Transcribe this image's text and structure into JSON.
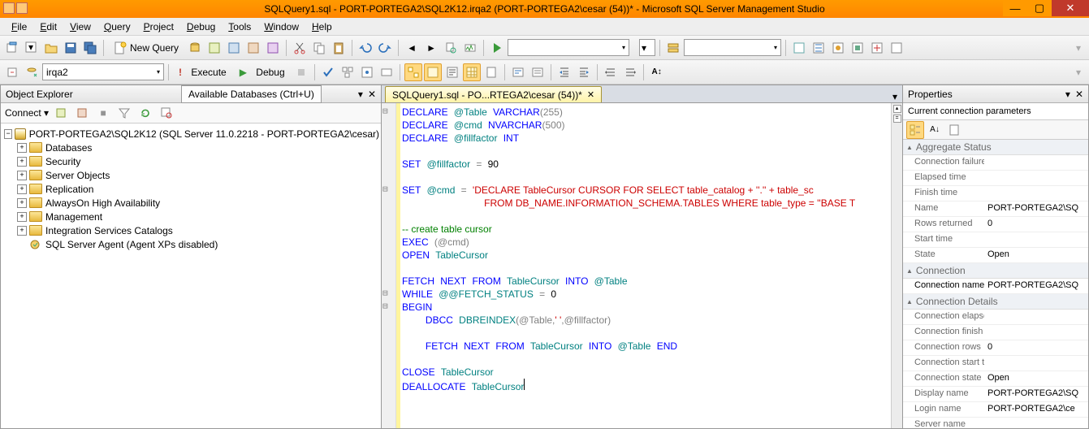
{
  "title": "SQLQuery1.sql - PORT-PORTEGA2\\SQL2K12.irqa2 (PORT-PORTEGA2\\cesar (54))* - Microsoft SQL Server Management Studio",
  "menu": [
    "File",
    "Edit",
    "View",
    "Query",
    "Project",
    "Debug",
    "Tools",
    "Window",
    "Help"
  ],
  "toolbar": {
    "new_query": "New Query",
    "execute": "Execute",
    "debug": "Debug",
    "db_combo": "irqa2",
    "avail_db_tip": "Available Databases (Ctrl+U)"
  },
  "object_explorer": {
    "title": "Object Explorer",
    "connect": "Connect",
    "root": "PORT-PORTEGA2\\SQL2K12 (SQL Server 11.0.2218 - PORT-PORTEGA2\\cesar)",
    "nodes": [
      "Databases",
      "Security",
      "Server Objects",
      "Replication",
      "AlwaysOn High Availability",
      "Management",
      "Integration Services Catalogs",
      "SQL Server Agent (Agent XPs disabled)"
    ]
  },
  "editor": {
    "tab": "SQLQuery1.sql - PO...RTEGA2\\cesar (54))*"
  },
  "sql": {
    "l1a": "DECLARE",
    "l1b": "@Table",
    "l1c": "VARCHAR",
    "l1d": "(255)",
    "l2a": "DECLARE",
    "l2b": "@cmd",
    "l2c": "NVARCHAR",
    "l2d": "(500)",
    "l3a": "DECLARE",
    "l3b": "@fillfactor",
    "l3c": "INT",
    "l4a": "SET",
    "l4b": "@fillfactor",
    "l4c": "=",
    "l4d": "90",
    "l5a": "SET",
    "l5b": "@cmd",
    "l5c": "=",
    "l5d": "'DECLARE TableCursor CURSOR FOR SELECT table_catalog + ''.'' + table_sc",
    "l6a": "FROM DB_NAME.INFORMATION_SCHEMA.TABLES WHERE table_type = ''BASE T",
    "l7a": "-- create table cursor",
    "l8a": "EXEC",
    "l8b": "(@cmd)",
    "l9a": "OPEN",
    "l9b": "TableCursor",
    "l10a": "FETCH",
    "l10b": "NEXT",
    "l10c": "FROM",
    "l10d": "TableCursor",
    "l10e": "INTO",
    "l10f": "@Table",
    "l11a": "WHILE",
    "l11b": "@@FETCH_STATUS",
    "l11c": "=",
    "l11d": "0",
    "l12a": "BEGIN",
    "l13a": "DBCC",
    "l13b": "DBREINDEX",
    "l13c": "(@Table,",
    "l13d": "' '",
    "l13e": ",@fillfactor)",
    "l14a": "FETCH",
    "l14b": "NEXT",
    "l14c": "FROM",
    "l14d": "TableCursor",
    "l14e": "INTO",
    "l14f": "@Table",
    "l14g": "END",
    "l15a": "CLOSE",
    "l15b": "TableCursor",
    "l16a": "DEALLOCATE",
    "l16b": "TableCursor"
  },
  "properties": {
    "title": "Properties",
    "sub": "Current connection parameters",
    "cats": {
      "agg": "Aggregate Status",
      "conn": "Connection",
      "conndet": "Connection Details"
    },
    "rows": {
      "conn_fail": {
        "k": "Connection failure",
        "v": ""
      },
      "elapsed": {
        "k": "Elapsed time",
        "v": ""
      },
      "finish": {
        "k": "Finish time",
        "v": ""
      },
      "name": {
        "k": "Name",
        "v": "PORT-PORTEGA2\\SQ"
      },
      "rowsret": {
        "k": "Rows returned",
        "v": "0"
      },
      "start": {
        "k": "Start time",
        "v": ""
      },
      "state": {
        "k": "State",
        "v": "Open"
      },
      "connname": {
        "k": "Connection name",
        "v": "PORT-PORTEGA2\\SQ"
      },
      "connelap": {
        "k": "Connection elapse",
        "v": ""
      },
      "connfin": {
        "k": "Connection finish",
        "v": ""
      },
      "connrows": {
        "k": "Connection rows",
        "v": "0"
      },
      "connstart": {
        "k": "Connection start t",
        "v": ""
      },
      "connstate": {
        "k": "Connection state",
        "v": "Open"
      },
      "disp": {
        "k": "Display name",
        "v": "PORT-PORTEGA2\\SQ"
      },
      "login": {
        "k": "Login name",
        "v": "PORT-PORTEGA2\\ce"
      },
      "server": {
        "k": "Server name",
        "v": ""
      }
    }
  }
}
